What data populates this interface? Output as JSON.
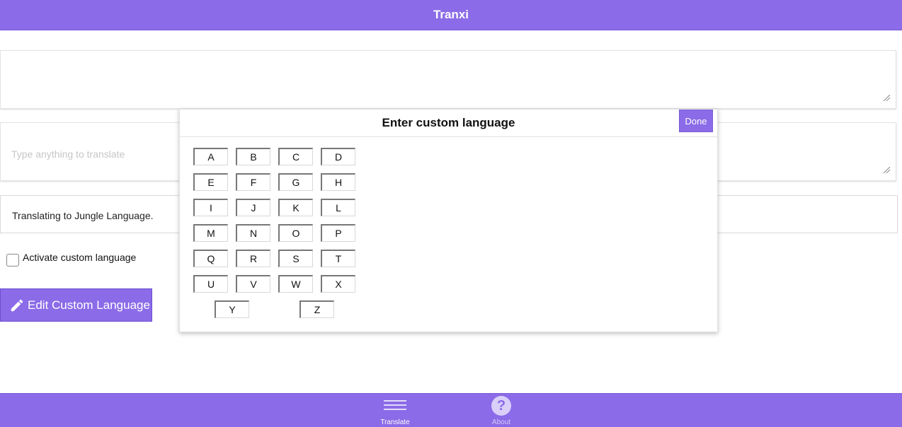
{
  "header": {
    "title": "Tranxi"
  },
  "input_area": {
    "value": ""
  },
  "output_area": {
    "placeholder": "Type anything to translate"
  },
  "status": {
    "text": "Translating to Jungle Language."
  },
  "custom_toggle": {
    "label": "Activate custom language",
    "checked": false
  },
  "edit_button": {
    "label": "Edit Custom Language",
    "icon": "pencil-icon"
  },
  "modal": {
    "title": "Enter custom language",
    "done_label": "Done",
    "keys": [
      "A",
      "B",
      "C",
      "D",
      "E",
      "F",
      "G",
      "H",
      "I",
      "J",
      "K",
      "L",
      "M",
      "N",
      "O",
      "P",
      "Q",
      "R",
      "S",
      "T",
      "U",
      "V",
      "W",
      "X",
      "Y",
      "Z"
    ]
  },
  "footer": {
    "nav": [
      {
        "label": "Translate",
        "icon": "menu-lines-icon",
        "active": true
      },
      {
        "label": "About",
        "icon": "question-icon",
        "active": false
      }
    ]
  },
  "colors": {
    "accent": "#8b6be8",
    "accent_light": "#d9cff8"
  }
}
